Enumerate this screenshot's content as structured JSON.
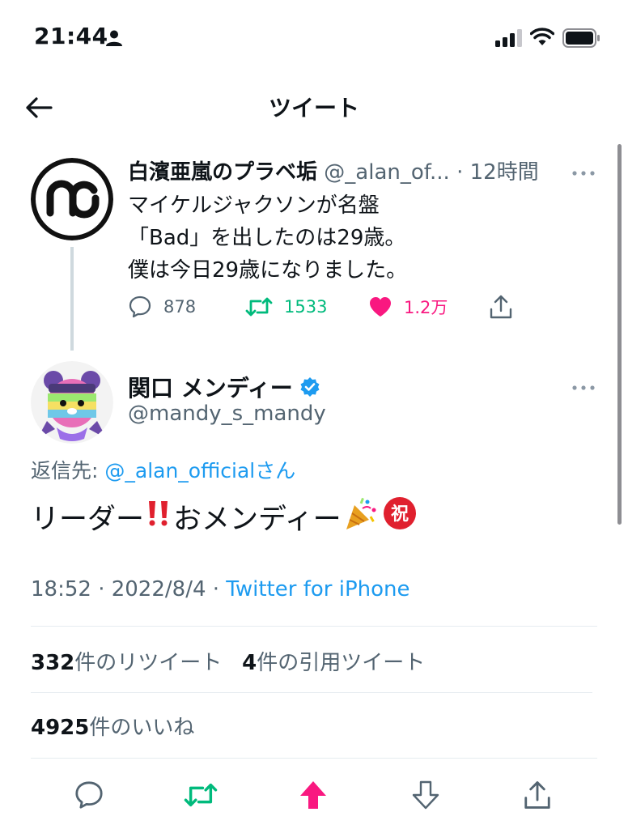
{
  "status_bar": {
    "time": "21:44",
    "icons": [
      "person-icon",
      "signal-icon",
      "wifi-icon",
      "battery-icon"
    ]
  },
  "nav": {
    "title": "ツイート",
    "back_icon": "back-arrow-icon"
  },
  "parent_tweet": {
    "name": "白濱亜嵐のプラベ垢",
    "handle": "@_alan_of...",
    "time": "· 12時間",
    "body_lines": [
      "マイケルジャクソンが名盤",
      "「Bad」を出したのは29歳。",
      "僕は今日29歳になりました。"
    ],
    "replies": "878",
    "retweets": "1533",
    "likes": "1.2万",
    "liked": true
  },
  "main_tweet": {
    "name": "関口 メンディー",
    "verified": true,
    "handle": "@mandy_s_mandy",
    "reply_prefix": "返信先: ",
    "reply_mention": "@_alan_official",
    "reply_suffix": "さん",
    "text_part1": "リーダー",
    "text_part2": "おメンディー",
    "emojis": [
      "double-exclamation-icon",
      "party-popper-icon",
      "congratulations-icon"
    ],
    "time": "18:52 · 2022/8/4 · ",
    "source": "Twitter for iPhone"
  },
  "stats": {
    "retweet_count": "332",
    "retweet_label": "件のリツイート",
    "quote_count": "4",
    "quote_label": "件の引用ツイート",
    "like_count": "4925",
    "like_label": "件のいいね"
  },
  "colors": {
    "accent_blue": "#1d9bf0",
    "retweet_green": "#00ba7c",
    "like_pink": "#f91880",
    "secondary_text": "#536471"
  }
}
